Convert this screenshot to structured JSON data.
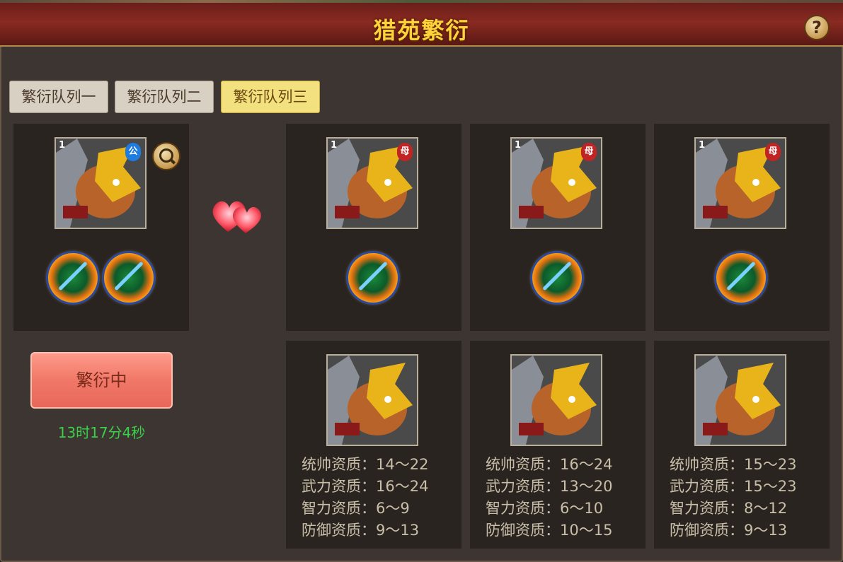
{
  "title": "猎苑繁衍",
  "tabs": [
    {
      "label": "繁衍队列一",
      "active": false
    },
    {
      "label": "繁衍队列二",
      "active": false
    },
    {
      "label": "繁衍队列三",
      "active": true
    }
  ],
  "parent": {
    "level": "1",
    "gender_tag": "公"
  },
  "offspring_top": [
    {
      "level": "1",
      "gender_tag": "母"
    },
    {
      "level": "1",
      "gender_tag": "母"
    },
    {
      "level": "1",
      "gender_tag": "母"
    }
  ],
  "breed_button": "繁衍中",
  "timer": "13时17分4秒",
  "candidates": [
    {
      "stats": [
        "统帅资质：14～22",
        "武力资质：16～24",
        "智力资质：6～9",
        "防御资质：9～13"
      ]
    },
    {
      "stats": [
        "统帅资质：16～24",
        "武力资质：13～20",
        "智力资质：6～10",
        "防御资质：10～15"
      ]
    },
    {
      "stats": [
        "统帅资质：15～23",
        "武力资质：15～23",
        "智力资质：8～12",
        "防御资质：9～13"
      ]
    }
  ],
  "help_label": "?"
}
